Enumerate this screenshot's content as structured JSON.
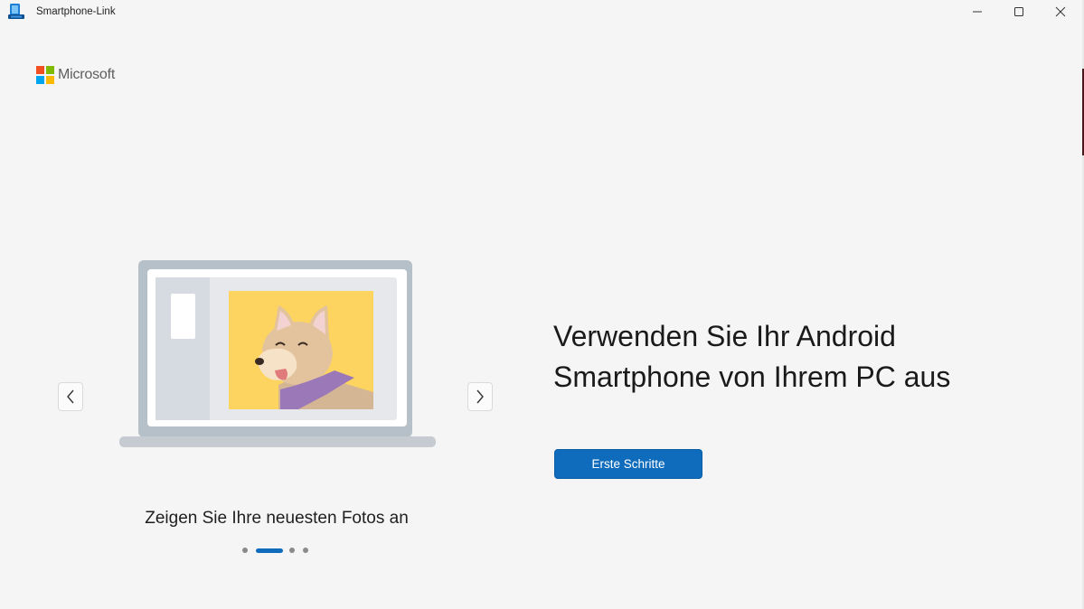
{
  "window": {
    "title": "Smartphone-Link",
    "controls": {
      "minimize_icon": "minimize-icon",
      "maximize_icon": "maximize-icon",
      "close_icon": "close-icon"
    }
  },
  "brand": {
    "name": "Microsoft",
    "colors": {
      "red": "#f25022",
      "green": "#7fba00",
      "blue": "#00a4ef",
      "yellow": "#ffb900"
    }
  },
  "carousel": {
    "caption": "Zeigen Sie Ihre neuesten Fotos an",
    "slide_count": 4,
    "active_slide": 2,
    "prev_icon": "chevron-left-icon",
    "next_icon": "chevron-right-icon"
  },
  "main": {
    "headline_line1": "Verwenden Sie Ihr Android",
    "headline_line2": "Smartphone von Ihrem PC aus",
    "cta_label": "Erste Schritte"
  },
  "colors": {
    "accent": "#0f6cbd",
    "background": "#f5f5f5"
  }
}
